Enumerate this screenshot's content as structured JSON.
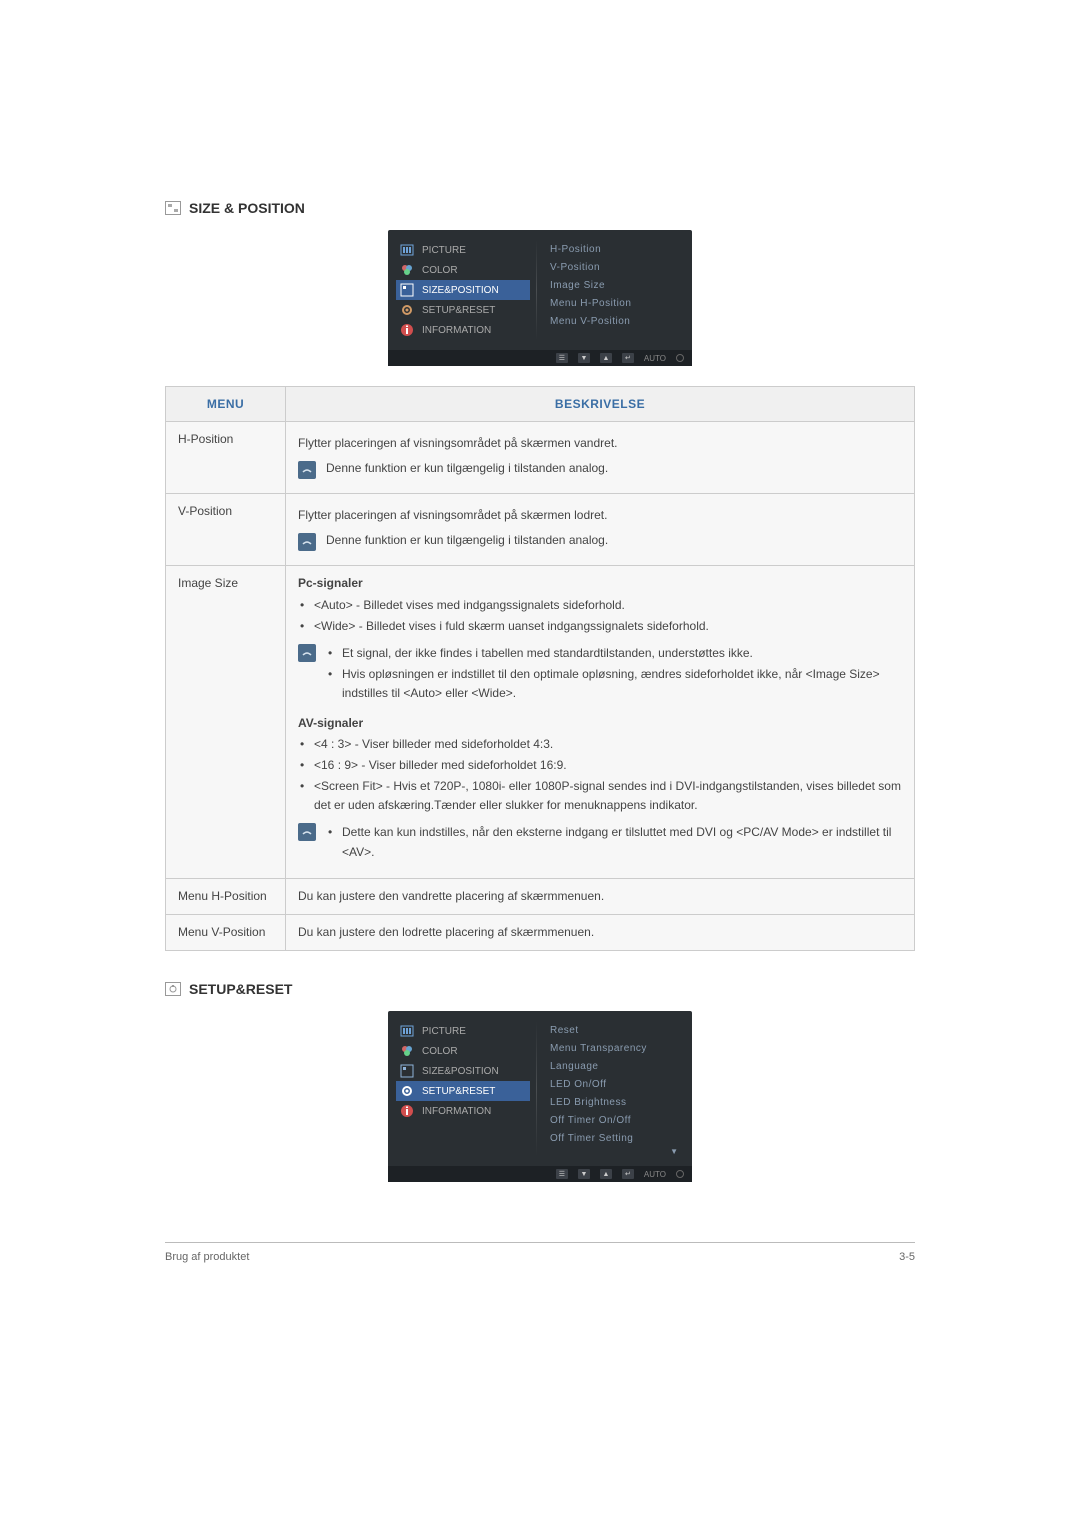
{
  "section1": {
    "title": "SIZE & POSITION",
    "osd_left": {
      "picture": "PICTURE",
      "color": "COLOR",
      "size_position": "SIZE&POSITION",
      "setup_reset": "SETUP&RESET",
      "information": "INFORMATION"
    },
    "osd_right": {
      "h_position": "H-Position",
      "v_position": "V-Position",
      "image_size": "Image Size",
      "menu_h_position": "Menu H-Position",
      "menu_v_position": "Menu V-Position"
    },
    "osd_auto": "AUTO"
  },
  "table1": {
    "header_menu": "MENU",
    "header_desc": "BESKRIVELSE",
    "rows": {
      "h_position": {
        "label": "H-Position",
        "line1": "Flytter placeringen af visningsområdet på skærmen vandret.",
        "note": "Denne funktion er kun tilgængelig i tilstanden analog."
      },
      "v_position": {
        "label": "V-Position",
        "line1": "Flytter placeringen af visningsområdet på skærmen lodret.",
        "note": "Denne funktion er kun tilgængelig i tilstanden analog."
      },
      "image_size": {
        "label": "Image Size",
        "pc_heading": "Pc-signaler",
        "pc_b1": "<Auto> - Billedet vises med indgangssignalets sideforhold.",
        "pc_b2": "<Wide> - Billedet vises i fuld skærm uanset indgangssignalets sideforhold.",
        "pc_note_b1": "Et signal, der ikke findes i tabellen med standardtilstanden, understøttes ikke.",
        "pc_note_b2": "Hvis opløsningen er indstillet til den optimale opløsning, ændres sideforholdet ikke, når <Image Size> indstilles til <Auto> eller <Wide>.",
        "av_heading": "AV-signaler",
        "av_b1": "<4 : 3> - Viser billeder med sideforholdet 4:3.",
        "av_b2": "<16 : 9> - Viser billeder med sideforholdet 16:9.",
        "av_b3": "<Screen Fit> - Hvis et 720P-, 1080i- eller 1080P-signal sendes ind i DVI-indgangstilstanden, vises billedet som det er uden afskæring.Tænder eller slukker for menuknappens indikator.",
        "av_note": "Dette kan kun indstilles, når den eksterne indgang er tilsluttet med DVI og <PC/AV Mode> er indstillet til <AV>."
      },
      "menu_h": {
        "label": "Menu H-Position",
        "line1": "Du kan justere den vandrette placering af skærmmenuen."
      },
      "menu_v": {
        "label": "Menu V-Position",
        "line1": "Du kan justere den lodrette placering af skærmmenuen."
      }
    }
  },
  "section2": {
    "title": "SETUP&RESET",
    "osd_right": {
      "reset": "Reset",
      "menu_transparency": "Menu Transparency",
      "language": "Language",
      "led_on_off": "LED On/Off",
      "led_brightness": "LED Brightness",
      "off_timer_on_off": "Off Timer On/Off",
      "off_timer_setting": "Off Timer Setting"
    },
    "arrow": "▼"
  },
  "footer": {
    "left": "Brug af produktet",
    "right": "3-5"
  }
}
